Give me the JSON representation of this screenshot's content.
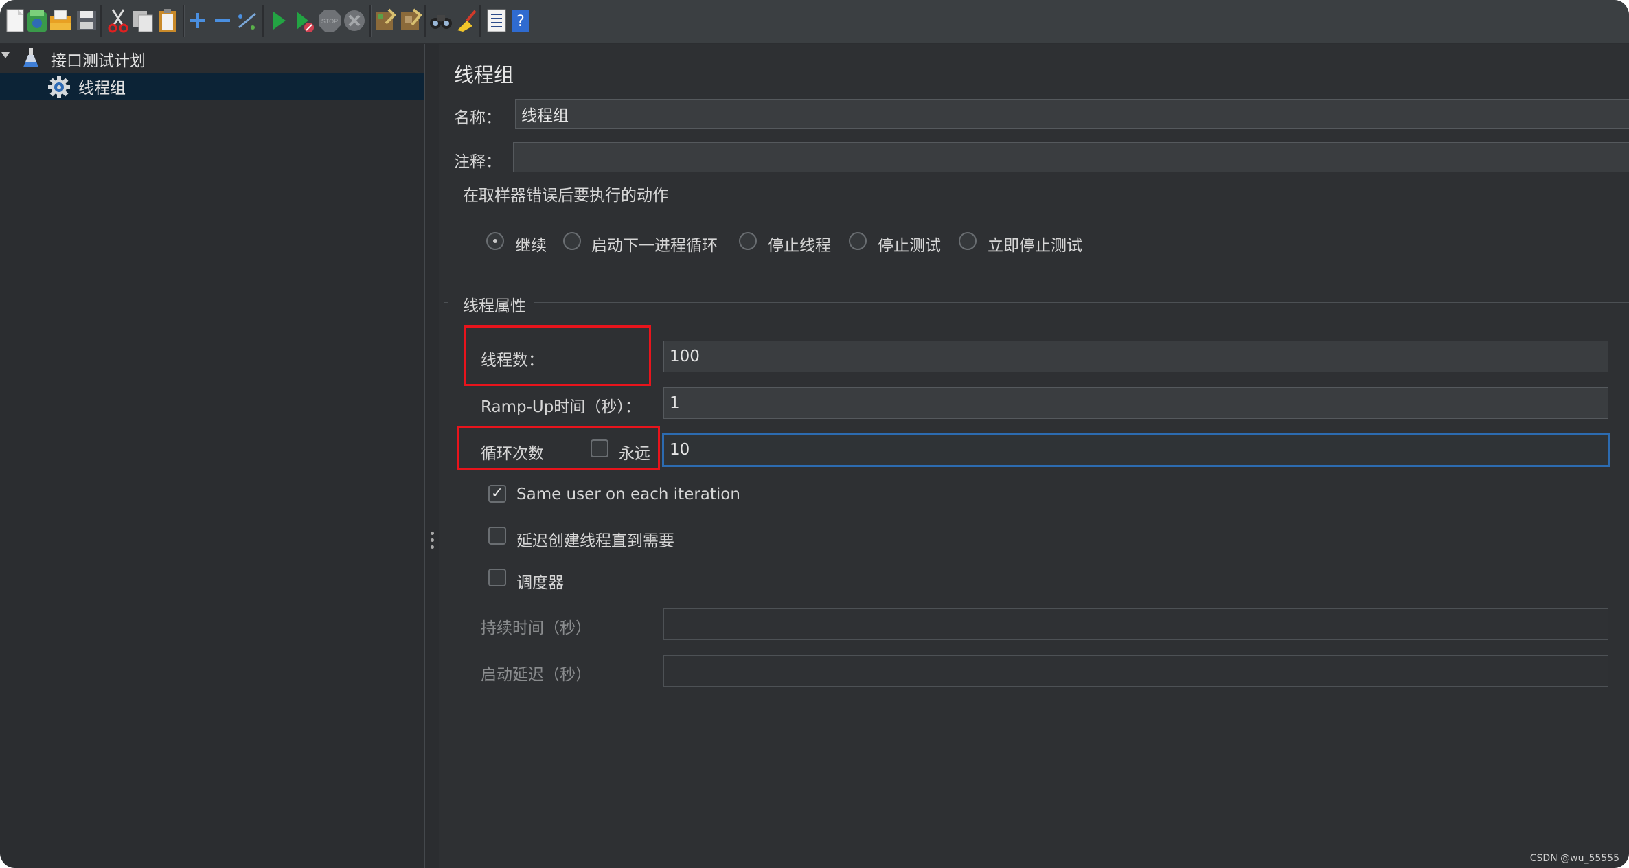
{
  "toolbar": {
    "icons": [
      "new-icon",
      "templates-icon",
      "open-icon",
      "save-icon",
      "cut-icon",
      "copy-icon",
      "paste-icon",
      "expand-icon",
      "collapse-icon",
      "toggle-icon",
      "start-icon",
      "start-no-pause-icon",
      "stop-icon",
      "shutdown-icon",
      "clear-icon",
      "clear-all-icon",
      "search-icon",
      "reset-search-icon",
      "function-helper-icon",
      "help-icon"
    ],
    "stop_text": "STOP"
  },
  "tree": {
    "items": [
      {
        "label": "接口测试计划",
        "icon": "test-plan-flask-icon"
      },
      {
        "label": "线程组",
        "icon": "thread-group-gear-icon"
      }
    ]
  },
  "panel": {
    "title": "线程组",
    "name_label": "名称：",
    "name_value": "线程组",
    "comment_label": "注释：",
    "comment_value": "",
    "error_section_title": "在取样器错误后要执行的动作",
    "error_actions": [
      {
        "label": "继续",
        "selected": true
      },
      {
        "label": "启动下一进程循环",
        "selected": false
      },
      {
        "label": "停止线程",
        "selected": false
      },
      {
        "label": "停止测试",
        "selected": false
      },
      {
        "label": "立即停止测试",
        "selected": false
      }
    ],
    "thread_section_title": "线程属性",
    "threads_label": "线程数：",
    "threads_value": "100",
    "rampup_label": "Ramp-Up时间（秒）：",
    "rampup_value": "1",
    "loop_label": "循环次数",
    "forever_label": "永远",
    "forever_checked": false,
    "loop_value": "10",
    "same_user_label": "Same user on each iteration",
    "same_user_checked": true,
    "delay_create_label": "延迟创建线程直到需要",
    "delay_create_checked": false,
    "scheduler_label": "调度器",
    "scheduler_checked": false,
    "duration_label": "持续时间（秒）",
    "duration_value": "",
    "startup_delay_label": "启动延迟（秒）",
    "startup_delay_value": ""
  },
  "watermark": "CSDN @wu_55555",
  "colors": {
    "highlight_red": "#e8141c",
    "focus_blue": "#2c6bb0",
    "selection": "#0c2336"
  }
}
